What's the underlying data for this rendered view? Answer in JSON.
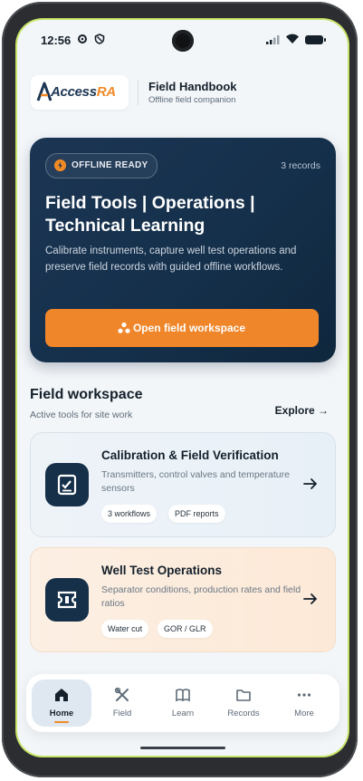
{
  "status_bar": {
    "time": "12:56"
  },
  "brand": {
    "logo_text_main": "Access",
    "logo_text_accent": "RA",
    "app_title": "Field Handbook",
    "app_subtitle": "Offline field companion"
  },
  "hero": {
    "badge": "OFFLINE READY",
    "records": "3 records",
    "title": "Field Tools | Operations | Technical Learning",
    "description": "Calibrate instruments, capture well test operations and preserve field records with guided offline workflows.",
    "cta_label": "Open field workspace"
  },
  "workspace": {
    "title": "Field workspace",
    "subtitle": "Active tools for site work",
    "explore_label": "Explore →",
    "cards": [
      {
        "title": "Calibration & Field Verification",
        "description": "Transmitters, control valves and temperature sensors",
        "chips": [
          "3 workflows",
          "PDF reports"
        ]
      },
      {
        "title": "Well Test Operations",
        "description": "Separator conditions, production rates and field ratios",
        "chips": [
          "Water cut",
          "GOR / GLR"
        ]
      }
    ]
  },
  "nav": {
    "items": [
      {
        "label": "Home",
        "icon": "home-icon",
        "active": true
      },
      {
        "label": "Field",
        "icon": "tools-icon"
      },
      {
        "label": "Learn",
        "icon": "book-icon"
      },
      {
        "label": "Records",
        "icon": "folder-icon"
      },
      {
        "label": "More",
        "icon": "more-icon"
      }
    ]
  },
  "colors": {
    "accent": "#f0862a",
    "navy": "#163049",
    "hero_bg": "#1b3553"
  }
}
